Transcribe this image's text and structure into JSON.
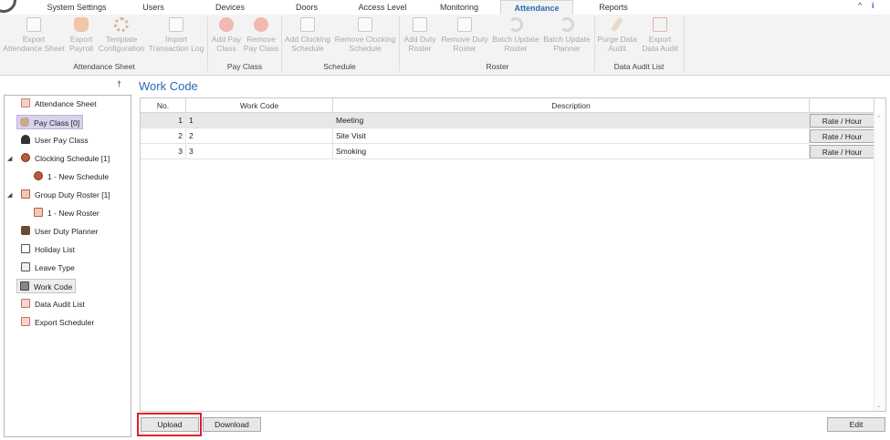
{
  "tabs": [
    "System Settings",
    "Users",
    "Devices",
    "Doors",
    "Access Level",
    "Monitoring",
    "Attendance",
    "Reports"
  ],
  "active_tab": "Attendance",
  "window_controls": [
    "^",
    "i"
  ],
  "ribbon": {
    "attendance_sheet": {
      "group_label": "Attendance Sheet",
      "buttons": [
        {
          "l1": "Export",
          "l2": "Attendance Sheet",
          "icon": "sheet-icon"
        },
        {
          "l1": "Export",
          "l2": "Payroll",
          "icon": "money-bag-icon"
        },
        {
          "l1": "Template",
          "l2": "Configuration",
          "icon": "gear-icon"
        },
        {
          "l1": "Import",
          "l2": "Transaction Log",
          "icon": "log-icon"
        }
      ]
    },
    "pay_class": {
      "group_label": "Pay Class",
      "buttons": [
        {
          "l1": "Add Pay",
          "l2": "Class",
          "icon": "add-icon"
        },
        {
          "l1": "Remove",
          "l2": "Pay Class",
          "icon": "remove-icon"
        }
      ]
    },
    "schedule": {
      "group_label": "Schedule",
      "buttons": [
        {
          "l1": "Add Clocking",
          "l2": "Schedule",
          "icon": "add-schedule-icon"
        },
        {
          "l1": "Remove Clocking",
          "l2": "Schedule",
          "icon": "remove-schedule-icon"
        }
      ]
    },
    "roster": {
      "group_label": "Roster",
      "buttons": [
        {
          "l1": "Add Duty",
          "l2": "Roster",
          "icon": "add-roster-icon"
        },
        {
          "l1": "Remove Duty",
          "l2": "Roster",
          "icon": "remove-roster-icon"
        },
        {
          "l1": "Batch Update",
          "l2": "Roster",
          "icon": "sync-icon"
        },
        {
          "l1": "Batch Update",
          "l2": "Planner",
          "icon": "sync-icon"
        }
      ]
    },
    "data_audit": {
      "group_label": "Data Audit List",
      "buttons": [
        {
          "l1": "Purge Data",
          "l2": "Audit",
          "icon": "broom-icon"
        },
        {
          "l1": "Export",
          "l2": "Data Audit",
          "icon": "export-icon"
        }
      ]
    }
  },
  "sidebar": {
    "pin": "†",
    "items": [
      {
        "label": "Attendance Sheet",
        "icon": "sheet-icon"
      },
      {
        "label": "Pay Class [0]",
        "icon": "money-bag-icon"
      },
      {
        "label": "User Pay Class",
        "icon": "user-icon"
      },
      {
        "label": "Clocking Schedule [1]",
        "icon": "clock-icon"
      },
      {
        "label": "1 - New Schedule",
        "icon": "clock-icon"
      },
      {
        "label": "Group Duty Roster [1]",
        "icon": "roster-icon"
      },
      {
        "label": "1 - New Roster",
        "icon": "roster-icon"
      },
      {
        "label": "User Duty Planner",
        "icon": "briefcase-icon"
      },
      {
        "label": "Holiday List",
        "icon": "gift-icon"
      },
      {
        "label": "Leave Type",
        "icon": "leave-icon"
      },
      {
        "label": "Work Code",
        "icon": "code-icon"
      },
      {
        "label": "Data Audit List",
        "icon": "audit-icon"
      },
      {
        "label": "Export Scheduler",
        "icon": "export-scheduler-icon"
      }
    ]
  },
  "main": {
    "title": "Work Code",
    "columns": [
      "No.",
      "Work Code",
      "Description",
      ""
    ],
    "rows": [
      {
        "no": "1",
        "code": "1",
        "desc": "Meeting",
        "action": "Rate / Hour"
      },
      {
        "no": "2",
        "code": "2",
        "desc": "Site Visit",
        "action": "Rate / Hour"
      },
      {
        "no": "3",
        "code": "3",
        "desc": "Smoking",
        "action": "Rate / Hour"
      }
    ],
    "buttons": {
      "upload": "Upload",
      "download": "Download",
      "edit": "Edit"
    }
  },
  "colors": {
    "accent": "#2a6ab3",
    "highlight": "#e0202a",
    "selected_item": "#d9d2ec"
  }
}
